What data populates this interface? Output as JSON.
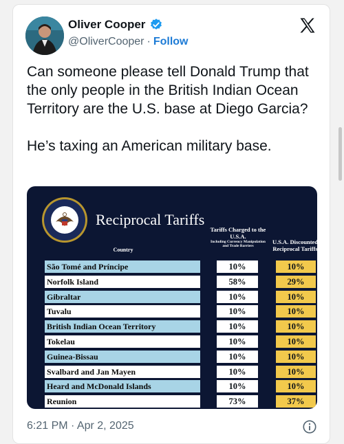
{
  "user": {
    "name": "Oliver Cooper",
    "handle": "@OliverCooper",
    "separator": "·",
    "follow_label": "Follow"
  },
  "tweet": {
    "paragraph1": "Can someone please tell Donald Trump that the only people in the British Indian Ocean Territory are the U.S. base at Diego Garcia?",
    "paragraph2": "He’s taxing an American military base."
  },
  "media": {
    "title": "Reciprocal Tariffs",
    "header_country": "Country",
    "header_charged": "Tariffs Charged to the U.S.A.",
    "header_charged_sub": "Including Currency Manipulation and Trade Barriers",
    "header_discounted": "U.S.A. Discounted Reciprocal Tariffs",
    "rows": [
      {
        "country": "São Tomé and Príncipe",
        "charged": "10%",
        "discounted": "10%"
      },
      {
        "country": "Norfolk Island",
        "charged": "58%",
        "discounted": "29%"
      },
      {
        "country": "Gibraltar",
        "charged": "10%",
        "discounted": "10%"
      },
      {
        "country": "Tuvalu",
        "charged": "10%",
        "discounted": "10%"
      },
      {
        "country": "British Indian Ocean Territory",
        "charged": "10%",
        "discounted": "10%"
      },
      {
        "country": "Tokelau",
        "charged": "10%",
        "discounted": "10%"
      },
      {
        "country": "Guinea-Bissau",
        "charged": "10%",
        "discounted": "10%"
      },
      {
        "country": "Svalbard and Jan Mayen",
        "charged": "10%",
        "discounted": "10%"
      },
      {
        "country": "Heard and McDonald Islands",
        "charged": "10%",
        "discounted": "10%"
      },
      {
        "country": "Reunion",
        "charged": "73%",
        "discounted": "37%"
      }
    ]
  },
  "footer": {
    "timestamp": "6:21 PM · Apr 2, 2025"
  },
  "icons": {
    "verified": "verified-badge-icon",
    "logo": "x-logo-icon",
    "info": "info-icon"
  },
  "colors": {
    "link": "#1d7bd6",
    "verified": "#1d9bf0",
    "chart_bg": "#0c1633",
    "row_blue": "#a8d4e6",
    "discount_yellow": "#f2c94c"
  }
}
